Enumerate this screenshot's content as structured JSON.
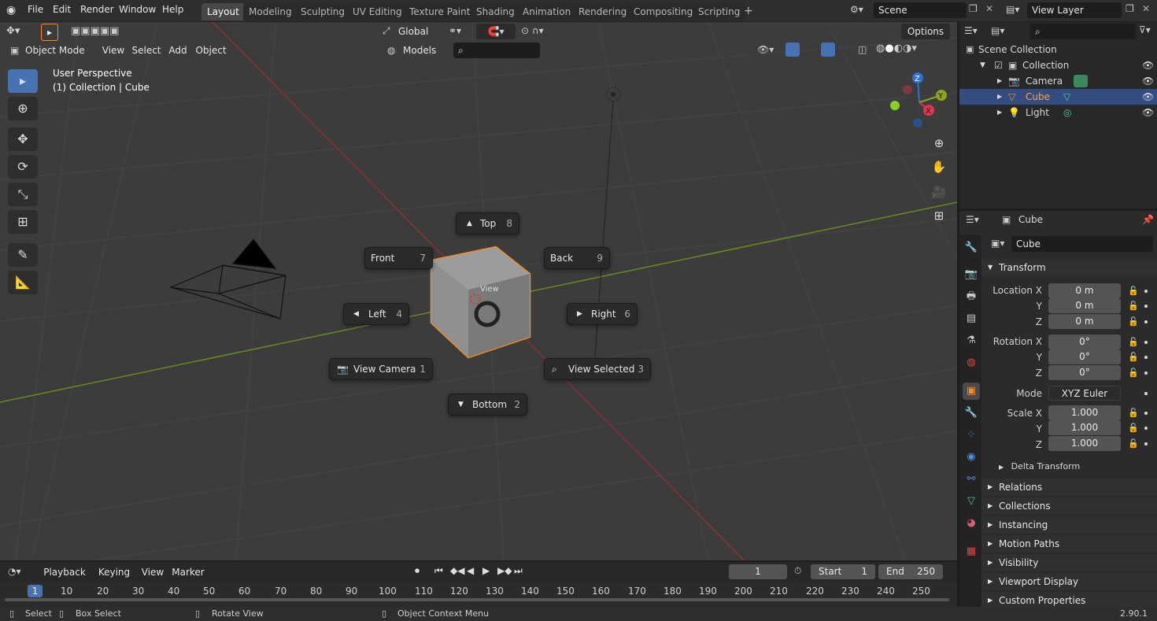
{
  "menus": [
    "File",
    "Edit",
    "Render",
    "Window",
    "Help"
  ],
  "workspaces": [
    "Layout",
    "Modeling",
    "Sculpting",
    "UV Editing",
    "Texture Paint",
    "Shading",
    "Animation",
    "Rendering",
    "Compositing",
    "Scripting"
  ],
  "active_workspace": "Layout",
  "scene": {
    "name": "Scene",
    "view_layer": "View Layer"
  },
  "viewport": {
    "mode": "Object Mode",
    "menus": [
      "View",
      "Select",
      "Add",
      "Object"
    ],
    "orientation": "Global",
    "models_filter": "Models",
    "options_label": "Options",
    "perspective": "User Perspective",
    "context": "(1) Collection | Cube",
    "cube_label": "View"
  },
  "pie_menu": {
    "top": {
      "label": "Top",
      "key": "8"
    },
    "front": {
      "label": "Front",
      "key": "7"
    },
    "back": {
      "label": "Back",
      "key": "9"
    },
    "left": {
      "label": "Left",
      "key": "4"
    },
    "right": {
      "label": "Right",
      "key": "6"
    },
    "view_camera": {
      "label": "View Camera",
      "key": "1"
    },
    "view_selected": {
      "label": "View Selected",
      "key": "3"
    },
    "bottom": {
      "label": "Bottom",
      "key": "2"
    }
  },
  "gizmo": {
    "x": "X",
    "y": "Y",
    "z": "Z"
  },
  "outliner": {
    "root": "Scene Collection",
    "collection": "Collection",
    "items": [
      {
        "name": "Camera",
        "icon": "camera-icon",
        "selected": false
      },
      {
        "name": "Cube",
        "icon": "mesh-icon",
        "selected": true
      },
      {
        "name": "Light",
        "icon": "light-icon",
        "selected": false
      }
    ]
  },
  "properties": {
    "object_name": "Cube",
    "name_field": "Cube",
    "transform_label": "Transform",
    "location_label": "Location X",
    "rotation_label": "Rotation X",
    "scale_label": "Scale X",
    "mode_label": "Mode",
    "y_label": "Y",
    "z_label": "Z",
    "location": [
      "0 m",
      "0 m",
      "0 m"
    ],
    "rotation": [
      "0°",
      "0°",
      "0°"
    ],
    "rotation_mode": "XYZ Euler",
    "scale": [
      "1.000",
      "1.000",
      "1.000"
    ],
    "delta_transform": "Delta Transform",
    "panels": [
      "Relations",
      "Collections",
      "Instancing",
      "Motion Paths",
      "Visibility",
      "Viewport Display",
      "Custom Properties"
    ]
  },
  "timeline": {
    "menus": [
      "Playback",
      "Keying",
      "View",
      "Marker"
    ],
    "current_frame": "1",
    "start_label": "Start",
    "start": "1",
    "end_label": "End",
    "end": "250",
    "ruler": [
      "1",
      "10",
      "20",
      "30",
      "40",
      "50",
      "60",
      "70",
      "80",
      "90",
      "100",
      "110",
      "120",
      "130",
      "140",
      "150",
      "160",
      "170",
      "180",
      "190",
      "200",
      "210",
      "220",
      "230",
      "240",
      "250"
    ]
  },
  "statusbar": {
    "select": "Select",
    "box_select": "Box Select",
    "rotate_view": "Rotate View",
    "context_menu": "Object Context Menu",
    "version": "2.90.1"
  },
  "colors": {
    "accent": "#4772b3",
    "selection": "#ff8c1a",
    "x_axis": "#8b2e36",
    "y_axis": "#6a8a1f"
  }
}
